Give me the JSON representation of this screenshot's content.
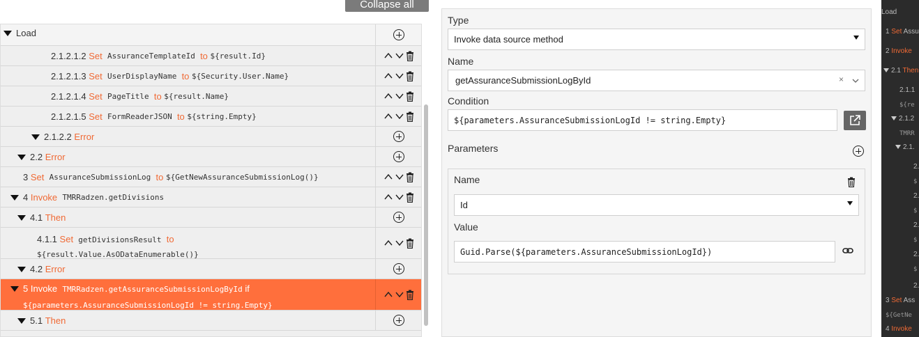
{
  "toolbar": {
    "collapse_label": "Collapse all"
  },
  "tree": {
    "root_label": "Load",
    "rows": [
      {
        "num": "2.1.2.1.2",
        "kw": "Set",
        "text": "AssuranceTemplateId",
        "kw2": "to",
        "val": "${result.Id}"
      },
      {
        "num": "2.1.2.1.3",
        "kw": "Set",
        "text": "UserDisplayName",
        "kw2": "to",
        "val": "${Security.User.Name}"
      },
      {
        "num": "2.1.2.1.4",
        "kw": "Set",
        "text": "PageTitle",
        "kw2": "to",
        "val": "${result.Name}"
      },
      {
        "num": "2.1.2.1.5",
        "kw": "Set",
        "text": "FormReaderJSON",
        "kw2": "to",
        "val": "${string.Empty}"
      },
      {
        "num": "2.1.2.2",
        "kw": "Error"
      },
      {
        "num": "2.2",
        "kw": "Error"
      },
      {
        "num": "3",
        "kw": "Set",
        "text": "AssuranceSubmissionLog",
        "kw2": "to",
        "val": "${GetNewAssuranceSubmissionLog()}"
      },
      {
        "num": "4",
        "kw": "Invoke",
        "text": "TMRRadzen.getDivisions"
      },
      {
        "num": "4.1",
        "kw": "Then"
      },
      {
        "num": "4.1.1",
        "kw": "Set",
        "text": "getDivisionsResult",
        "kw2": "to",
        "val": "${result.Value.AsODataEnumerable()}"
      },
      {
        "num": "4.2",
        "kw": "Error"
      },
      {
        "num": "5",
        "kw": "Invoke",
        "text": "TMRRadzen.getAssuranceSubmissionLogById",
        "kw2": "if",
        "val": "${parameters.AssuranceSubmissionLogId != string.Empty}"
      },
      {
        "num": "5.1",
        "kw": "Then"
      }
    ]
  },
  "panel": {
    "type_label": "Type",
    "type_value": "Invoke data source method",
    "name_label": "Name",
    "name_value": "getAssuranceSubmissionLogById",
    "clear_symbol": "×",
    "condition_label": "Condition",
    "condition_value": "${parameters.AssuranceSubmissionLogId != string.Empty}",
    "parameters_label": "Parameters",
    "param": {
      "name_label": "Name",
      "name_value": "Id",
      "value_label": "Value",
      "value_value": "Guid.Parse(${parameters.AssuranceSubmissionLogId})"
    }
  },
  "dark_strip": {
    "items": [
      {
        "t": "Load"
      },
      {
        "n": "1",
        "k": "Set",
        "t": "Assu"
      },
      {
        "n": "2",
        "k": "Invoke"
      },
      {
        "n": "2.1",
        "k": "Then"
      },
      {
        "n": "2.1.1"
      },
      {
        "t": "${re"
      },
      {
        "n": "2.1.2"
      },
      {
        "t": "TMRR"
      },
      {
        "n": "2.1."
      },
      {
        "n": "2."
      },
      {
        "t": "$"
      },
      {
        "n": "2."
      },
      {
        "t": "$"
      },
      {
        "n": "2."
      },
      {
        "t": "$"
      },
      {
        "n": "2."
      },
      {
        "t": "$"
      },
      {
        "n": "2."
      },
      {
        "t": "$"
      },
      {
        "n": "3",
        "k": "Set",
        "t": "Ass"
      },
      {
        "t": "${GetNe"
      },
      {
        "n": "4",
        "k": "Invoke"
      }
    ]
  },
  "colors": {
    "accent": "#f06a35",
    "selected_row": "#ff6f3c",
    "dark_bg": "#2b2b2b"
  }
}
